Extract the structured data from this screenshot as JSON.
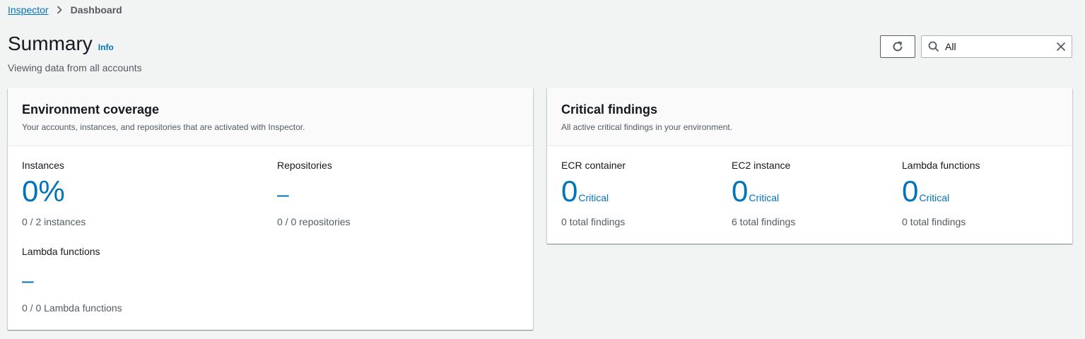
{
  "breadcrumb": {
    "root": "Inspector",
    "current": "Dashboard"
  },
  "header": {
    "title": "Summary",
    "info": "Info",
    "subtitle": "Viewing data from all accounts"
  },
  "filter": {
    "value": "All",
    "placeholder": ""
  },
  "coverage": {
    "title": "Environment coverage",
    "description": "Your accounts, instances, and repositories that are activated with Inspector.",
    "instances": {
      "label": "Instances",
      "value": "0%",
      "sub": "0 / 2 instances"
    },
    "repositories": {
      "label": "Repositories",
      "value": "–",
      "sub": "0 / 0 repositories"
    },
    "lambda": {
      "label": "Lambda functions",
      "value": "–",
      "sub": "0 / 0 Lambda functions"
    }
  },
  "critical": {
    "title": "Critical findings",
    "description": "All active critical findings in your environment.",
    "items": [
      {
        "label": "ECR container",
        "count": "0",
        "severity": "Critical",
        "sub": "0 total findings"
      },
      {
        "label": "EC2 instance",
        "count": "0",
        "severity": "Critical",
        "sub": "6 total findings"
      },
      {
        "label": "Lambda functions",
        "count": "0",
        "severity": "Critical",
        "sub": "0 total findings"
      }
    ]
  },
  "colors": {
    "link": "#0073bb",
    "text": "#16191f",
    "muted": "#545b64",
    "background": "#f2f3f3"
  }
}
